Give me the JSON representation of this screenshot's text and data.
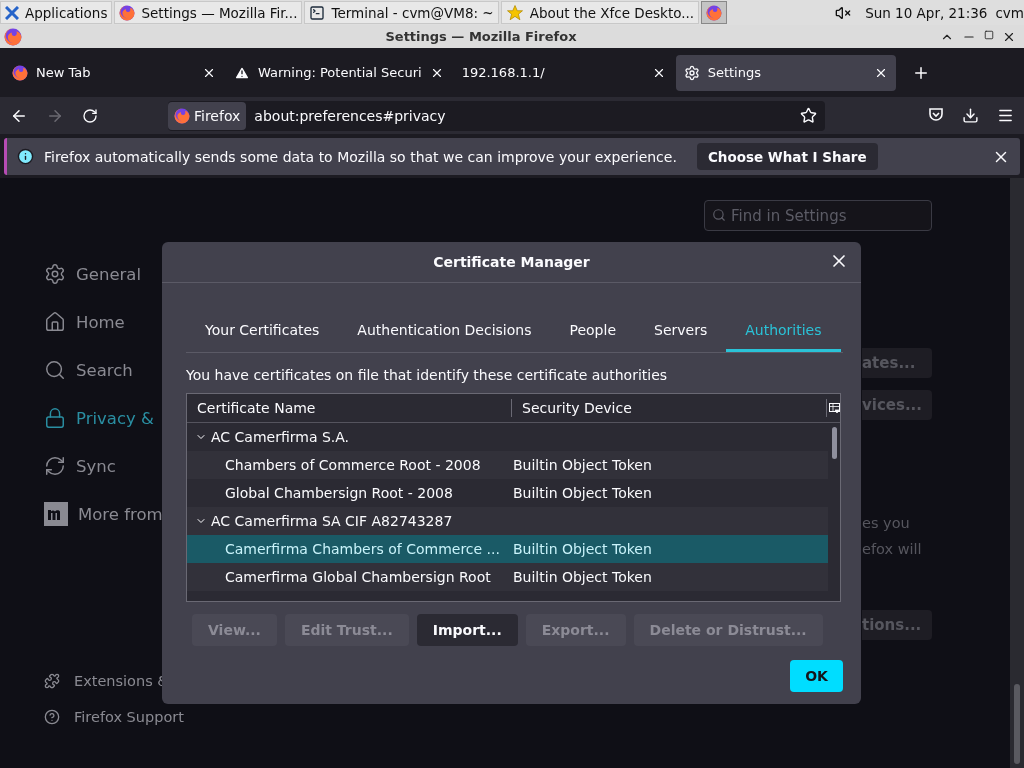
{
  "taskbar": {
    "items": [
      {
        "kind": "menu",
        "label": "Applications"
      },
      {
        "kind": "firefox",
        "label": "Settings — Mozilla Fir...",
        "selected": false
      },
      {
        "kind": "terminal",
        "label": "Terminal - cvm@VM8: ~",
        "selected": false
      },
      {
        "kind": "star",
        "label": "About the Xfce Deskto...",
        "selected": false
      },
      {
        "kind": "firefox",
        "selected": true
      }
    ],
    "clock": "Sun 10 Apr, 21:36",
    "user": "cvm"
  },
  "window": {
    "title": "Settings — Mozilla Firefox"
  },
  "tabs": [
    {
      "kind": "firefox",
      "label": "New Tab",
      "selected": false
    },
    {
      "kind": "warning",
      "label": "Warning: Potential Securi",
      "selected": false
    },
    {
      "kind": "none",
      "label": "192.168.1.1/",
      "selected": false
    },
    {
      "kind": "settings",
      "label": "Settings",
      "selected": true
    }
  ],
  "address_bar": {
    "identity": "Firefox",
    "url": "about:preferences#privacy"
  },
  "notification": {
    "text": "Firefox automatically sends some data to Mozilla so that we can improve your experience.",
    "button": "Choose What I Share"
  },
  "search": {
    "placeholder": "Find in Settings"
  },
  "sidebar": {
    "items": [
      {
        "kind": "general",
        "label": "General",
        "selected": false
      },
      {
        "kind": "home",
        "label": "Home",
        "selected": false
      },
      {
        "kind": "search",
        "label": "Search",
        "selected": false
      },
      {
        "kind": "privacy",
        "label": "Privacy &",
        "selected": true
      },
      {
        "kind": "sync",
        "label": "Sync",
        "selected": false
      },
      {
        "kind": "more",
        "label": "More from",
        "selected": false
      }
    ],
    "footer": [
      {
        "kind": "extensions",
        "label": "Extensions &"
      },
      {
        "kind": "support",
        "label": "Firefox Support"
      }
    ]
  },
  "background_fragments": [
    {
      "kind": "button",
      "text": "ates..."
    },
    {
      "kind": "button",
      "text": "vices..."
    },
    {
      "kind": "text",
      "text": "es you"
    },
    {
      "kind": "text",
      "text": "efox will"
    },
    {
      "kind": "button",
      "text": "tions..."
    }
  ],
  "dialog": {
    "title": "Certificate Manager",
    "tabs": [
      {
        "label": "Your Certificates",
        "selected": false
      },
      {
        "label": "Authentication Decisions",
        "selected": false
      },
      {
        "label": "People",
        "selected": false
      },
      {
        "label": "Servers",
        "selected": false
      },
      {
        "label": "Authorities",
        "selected": true
      }
    ],
    "description": "You have certificates on file that identify these certificate authorities",
    "table": {
      "columns": [
        "Certificate Name",
        "Security Device"
      ],
      "rows": [
        {
          "name": "AC Camerfirma S.A.",
          "expanded": true,
          "children": [
            {
              "name": "Chambers of Commerce Root - 2008",
              "device": "Builtin Object Token",
              "selected": false
            },
            {
              "name": "Global Chambersign Root - 2008",
              "device": "Builtin Object Token",
              "selected": false
            }
          ]
        },
        {
          "name": "AC Camerfirma SA CIF A82743287",
          "expanded": true,
          "children": [
            {
              "name": "Camerfirma Chambers of Commerce ...",
              "device": "Builtin Object Token",
              "selected": true
            },
            {
              "name": "Camerfirma Global Chambersign Root",
              "device": "Builtin Object Token",
              "selected": false
            }
          ]
        }
      ]
    },
    "buttons": [
      {
        "label": "View...",
        "disabled": true
      },
      {
        "label": "Edit Trust...",
        "disabled": true
      },
      {
        "label": "Import...",
        "disabled": false
      },
      {
        "label": "Export...",
        "disabled": true
      },
      {
        "label": "Delete or Distrust...",
        "disabled": true
      }
    ],
    "ok": "OK"
  }
}
